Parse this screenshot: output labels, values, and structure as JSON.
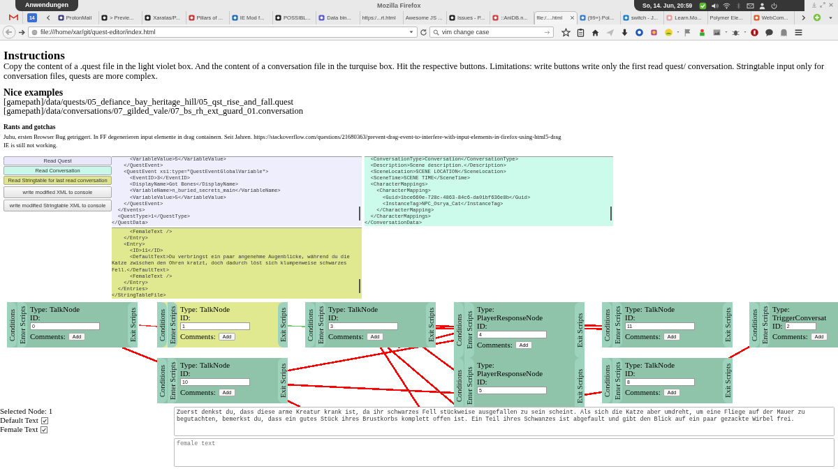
{
  "system_bar": {
    "apps_button": "Anwendungen",
    "title": "Mozilla Firefox",
    "clock": "So, 14. Jun, 20:59"
  },
  "pinned_calendar_day": "14",
  "tabs": [
    {
      "label": "ProtonMail",
      "selected": false
    },
    {
      "label": "> Previe...",
      "selected": false
    },
    {
      "label": "Xaratas/P...",
      "selected": false
    },
    {
      "label": "Pillars of ...",
      "selected": false
    },
    {
      "label": "IE Mod f...",
      "selected": false
    },
    {
      "label": "POSSIBL...",
      "selected": false
    },
    {
      "label": "Data bin...",
      "selected": false
    },
    {
      "label": "https:/...rt.html",
      "selected": false
    },
    {
      "label": "Awesome JS ...",
      "selected": false
    },
    {
      "label": "Issues - P...",
      "selected": false
    },
    {
      "label": "::AniDB.n...",
      "selected": false
    },
    {
      "label": "file:/....html",
      "selected": true
    },
    {
      "label": "(99+) Pol...",
      "selected": false
    },
    {
      "label": "switch - J...",
      "selected": false
    },
    {
      "label": "Learn.Mo...",
      "selected": false
    },
    {
      "label": "Polymer Ele...",
      "selected": false
    },
    {
      "label": "WebCom...",
      "selected": false
    }
  ],
  "address_bar": {
    "url": "file:///home/xar/git/quest-editor/index.html"
  },
  "search": {
    "value": "vim change case"
  },
  "page": {
    "title": "Instructions",
    "intro": "Copy the content of a .quest file in the light violet box. And the content of a conversation file in the turquise box. Hit the respective buttons. Limitations: write buttons write only the first read quest/ conversation. Stringtable input only for conversation files, quests are more complex.",
    "examples_heading": "Nice examples",
    "examples": [
      "[gamepath]/data/quests/05_defiance_bay_heritage_hill/05_qst_rise_and_fall.quest",
      "[gamepath]/data/conversations/07_gilded_vale/07_bs_rh_ext_guard_01.conversation"
    ],
    "rants_heading": "Rants and gotchas",
    "rants": [
      "Juhu, ersten Browser Bug getriggert. In FF degenerieren input elemente in drag containern. Seit Jahren. https://stackoverflow.com/questions/21680363/prevent-drag-event-to-interfere-with-input-elements-in-firefox-using-html5-drag",
      "IE is still not working."
    ]
  },
  "buttons": [
    {
      "label": "Read Quest",
      "kind": "quest"
    },
    {
      "label": "Read Conversation",
      "kind": "conversation"
    },
    {
      "label": "Read Stringtable for last read conversation",
      "kind": "stringtable"
    },
    {
      "label": "write modified XML to console",
      "kind": "plain"
    },
    {
      "label": "write modified Stringtable XML to console",
      "kind": "plain"
    }
  ],
  "editors": [
    {
      "kind": "quest",
      "lines": [
        "      <VariableValue>5</VariableValue>",
        "    </QuestEvent>",
        "    <QuestEvent xsi:type=\"QuestEventGlobalVariable\">",
        "      <EventID>3</EventID>",
        "      <DisplayName>Got Bones</DisplayName>",
        "      <VariableName>n_buried_secrets_main</VariableName>",
        "      <VariableValue>5</VariableValue>",
        "    </QuestEvent>",
        "  </Events>",
        "  <QuestType>1</QuestType>",
        "</QuestData>"
      ]
    },
    {
      "kind": "conversation",
      "lines": [
        "  <ConversationType>Conversation</ConversationType>",
        "  <Description>Scene description.</Description>",
        "  <SceneLocation>SCENE LOCATION</SceneLocation>",
        "  <SceneTime>SCENE TIME</SceneTime>",
        "  <CharacterMappings>",
        "    <CharacterMapping>",
        "      <Guid>1bce660e-728c-4863-84c6-da01bf636e8b</Guid>",
        "      <InstanceTag>NPC_Osrya_Cat</InstanceTag>",
        "    </CharacterMapping>",
        "  </CharacterMappings>",
        "</ConversationData>"
      ]
    },
    {
      "kind": "stringtable",
      "lines": [
        "      <FemaleText />",
        "    </Entry>",
        "    <Entry>",
        "      <ID>11</ID>",
        "      <DefaultText>Du verbringst ein paar angenehme Augenblicke, während du die Katze zwischen den Ohren kratzt, doch dadurch löst sich klumpenweise schwarzes Fell.</DefaultText>",
        "      <FemaleText />",
        "    </Entry>",
        "  </Entries>",
        "</StringTableFile>"
      ]
    }
  ],
  "nodes": [
    {
      "kind": "talk",
      "selected": false,
      "conditions": "Conditions",
      "enter": "Enter Scripts",
      "exit": "Exit Scripts",
      "type_label": "Type:",
      "type": "TalkNode",
      "id_label": "ID:",
      "id": "0",
      "comments_label": "Comments:",
      "add": "Add"
    },
    {
      "kind": "talk",
      "selected": true,
      "conditions": "Conditions",
      "enter": "Enter Scripts",
      "exit": "Exit Scripts",
      "type_label": "Type:",
      "type": "TalkNode",
      "id_label": "ID:",
      "id": "1",
      "comments_label": "Comments:",
      "add": "Add"
    },
    {
      "kind": "talk",
      "selected": false,
      "conditions": "Conditions",
      "enter": "Enter Scripts",
      "exit": "Exit Scripts",
      "type_label": "Type:",
      "type": "TalkNode",
      "id_label": "ID:",
      "id": "3",
      "comments_label": "Comments:",
      "add": "Add"
    },
    {
      "kind": "response",
      "selected": false,
      "conditions": "Conditions",
      "enter": "Enter Scripts",
      "exit": "Exit Scripts",
      "type_label": "Type:",
      "type": "PlayerResponseNode",
      "id_label": "ID:",
      "id": "4",
      "comments_label": "Comments:",
      "add": "Add"
    },
    {
      "kind": "talk",
      "selected": false,
      "conditions": "Conditions",
      "enter": "Enter Scripts",
      "exit": "Exit Scripts",
      "type_label": "Type:",
      "type": "TalkNode",
      "id_label": "ID:",
      "id": "11",
      "comments_label": "Comments:",
      "add": "Add"
    },
    {
      "kind": "trigger",
      "selected": false,
      "conditions": "Conditions",
      "enter": "Enter Scripts",
      "type_label": "Type:",
      "type": "TriggerConversat",
      "id_label": "ID:",
      "id": "2",
      "comments_label": "Comments:",
      "add": "Add"
    },
    {
      "kind": "talk",
      "selected": false,
      "conditions": "Conditions",
      "enter": "Enter Scripts",
      "exit": "Exit Scripts",
      "type_label": "Type:",
      "type": "TalkNode",
      "id_label": "ID:",
      "id": "10",
      "comments_label": "Comments:",
      "add": "Add"
    },
    {
      "kind": "response",
      "selected": false,
      "conditions": "Conditions",
      "enter": "Enter Scripts",
      "exit": "Exit Scripts",
      "type_label": "Type:",
      "type": "PlayerResponseNode",
      "id_label": "ID:",
      "id": "5"
    },
    {
      "kind": "talk",
      "selected": false,
      "conditions": "Conditions",
      "enter": "Enter Scripts",
      "exit": "Exit Scripts",
      "type_label": "Type:",
      "type": "TalkNode",
      "id_label": "ID:",
      "id": "8",
      "comments_label": "Comments:",
      "add": "Add"
    }
  ],
  "connectors": [
    {
      "color": "#ff3333"
    },
    {
      "color": "#66cc66"
    },
    {
      "color": "#ff0000"
    },
    {
      "color": "#ff0000"
    },
    {
      "color": "#ff0000"
    },
    {
      "color": "#ff0000"
    },
    {
      "color": "#ff0000"
    },
    {
      "color": "#ff0000"
    },
    {
      "color": "#ff0000"
    },
    {
      "color": "#ff0000"
    },
    {
      "color": "#ff0000"
    },
    {
      "color": "#ff0000"
    },
    {
      "color": "#ff0000"
    },
    {
      "color": "#ff0000"
    },
    {
      "color": "#ff0000"
    },
    {
      "color": "#ff0000"
    }
  ],
  "selection": {
    "label": "Selected Node: 1",
    "default_text": {
      "label": "Default Text",
      "checked": true
    },
    "female_text": {
      "label": "Female Text",
      "checked": true
    }
  },
  "default_text": {
    "value": "Zuerst denkst du, dass diese arme Kreatur krank ist, da ihr schwarzes Fell stückweise ausgefallen zu sein scheint. Als sich die Katze aber umdreht, um eine Fliege auf der Mauer zu begutachten, bemerkst du, dass ein gutes Stück ihres Brustkorbs komplett offen ist. Ein Teil ihres Schwanzes ist abgefault und gibt den Blick auf ein paar gezackte Wirbel frei."
  },
  "female_text": {
    "placeholder": "female text"
  }
}
